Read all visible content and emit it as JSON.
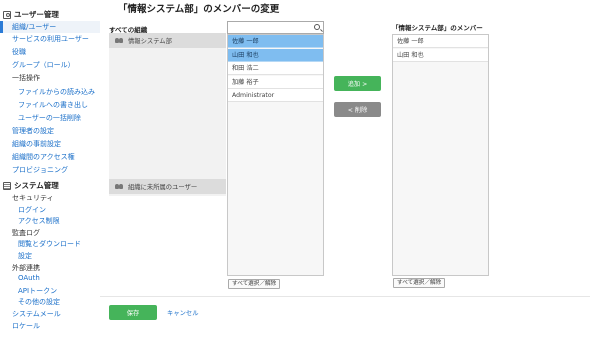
{
  "sidebar": {
    "user_section": "ユーザー管理",
    "user_items": [
      {
        "label": "組織/ユーザー",
        "active": true
      },
      {
        "label": "サービスの利用ユーザー"
      },
      {
        "label": "役職"
      },
      {
        "label": "グループ（ロール）"
      },
      {
        "label": "一括操作",
        "plain": true
      },
      {
        "label": "ファイルからの読み込み"
      },
      {
        "label": "ファイルへの書き出し"
      },
      {
        "label": "ユーザーの一括削除"
      },
      {
        "label": "管理者の設定"
      },
      {
        "label": "組織の事前設定"
      },
      {
        "label": "組織間のアクセス権"
      },
      {
        "label": "プロビジョニング"
      }
    ],
    "system_section": "システム管理",
    "system_items": [
      {
        "label": "セキュリティ",
        "plain": true
      },
      {
        "label": "ログイン"
      },
      {
        "label": "アクセス制限"
      },
      {
        "label": "監査ログ",
        "plain": true
      },
      {
        "label": "閲覧とダウンロード"
      },
      {
        "label": "設定"
      },
      {
        "label": "外部連携",
        "plain": true
      },
      {
        "label": "OAuth"
      },
      {
        "label": "APIトークン"
      },
      {
        "label": "その他の設定"
      },
      {
        "label": "システムメール"
      },
      {
        "label": "ロケール"
      }
    ]
  },
  "page": {
    "title": "「情報システム部」のメンバーの変更"
  },
  "all_orgs": {
    "label": "すべての組織",
    "items": [
      "情報システム部"
    ],
    "unassigned": "組織に未所属のユーザー"
  },
  "search": {
    "value": "",
    "placeholder": ""
  },
  "users": {
    "items": [
      {
        "name": "佐藤 一郎",
        "selected": true
      },
      {
        "name": "山田 和也",
        "selected": true
      },
      {
        "name": "和田 浩二",
        "selected": false
      },
      {
        "name": "加藤 裕子",
        "selected": false
      },
      {
        "name": "Administrator",
        "selected": false
      }
    ],
    "select_all": "すべて選択／解除"
  },
  "actions": {
    "add": "追加 >",
    "remove": "< 削除"
  },
  "members": {
    "label": "「情報システム部」のメンバー",
    "items": [
      "佐藤 一郎",
      "山田 和也"
    ],
    "select_all": "すべて選択／解除"
  },
  "footer": {
    "save": "保存",
    "cancel": "キャンセル"
  }
}
